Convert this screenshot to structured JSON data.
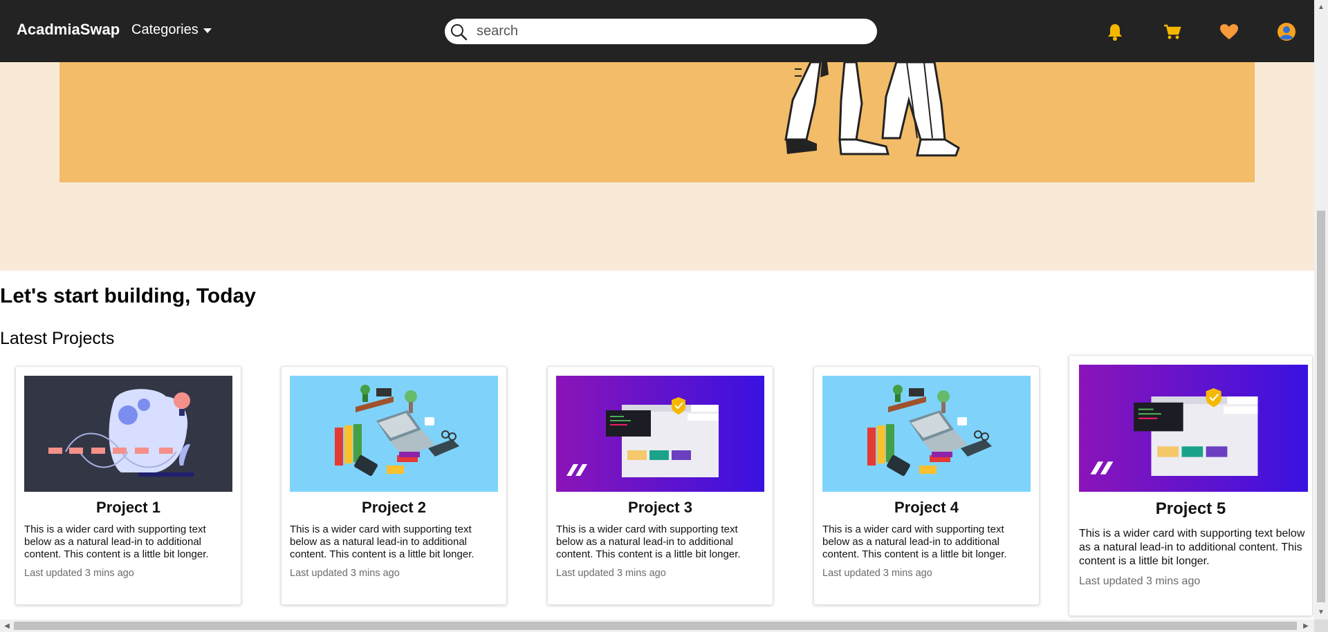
{
  "navbar": {
    "brand": "AcadmiaSwap",
    "categories_label": "Categories",
    "search_placeholder": "search",
    "icons": [
      "bell-icon",
      "cart-icon",
      "heart-icon",
      "user-avatar-icon"
    ],
    "background": "#242323"
  },
  "hero": {
    "banner_color": "#f2bc69",
    "background": "#f8ead6"
  },
  "main": {
    "heading": "Let's start building, Today",
    "subheading": "Latest Projects"
  },
  "projects": [
    {
      "title": "Project 1",
      "text": "This is a wider card with supporting text below as a natural lead-in to additional content. This content is a little bit longer.",
      "updated": "Last updated 3 mins ago",
      "image": "network-illustration"
    },
    {
      "title": "Project 2",
      "text": "This is a wider card with supporting text below as a natural lead-in to additional content. This content is a little bit longer.",
      "updated": "Last updated 3 mins ago",
      "image": "workspace-illustration"
    },
    {
      "title": "Project 3",
      "text": "This is a wider card with supporting text below as a natural lead-in to additional content. This content is a little bit longer.",
      "updated": "Last updated 3 mins ago",
      "image": "web-security-illustration"
    },
    {
      "title": "Project 4",
      "text": "This is a wider card with supporting text below as a natural lead-in to additional content. This content is a little bit longer.",
      "updated": "Last updated 3 mins ago",
      "image": "workspace-illustration"
    },
    {
      "title": "Project 5",
      "text": "This is a wider card with supporting text below as a natural lead-in to additional content. This content is a little bit longer.",
      "updated": "Last updated 3 mins ago",
      "image": "web-security-illustration"
    }
  ]
}
